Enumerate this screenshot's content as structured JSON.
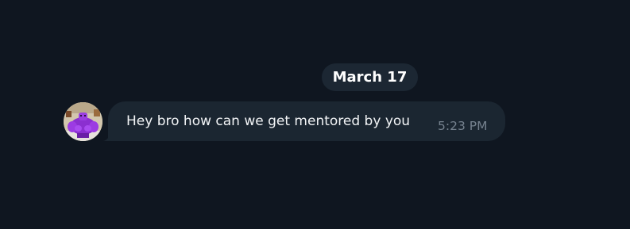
{
  "conversation": {
    "date_separator": "March 17",
    "messages": [
      {
        "text": "Hey bro how can we get mentored by you",
        "time": "5:23 PM",
        "sender_avatar": "purple-muscle-character-avatar"
      }
    ]
  },
  "colors": {
    "background": "#0f1620",
    "bubble": "#1b2631",
    "date_chip": "#1c2733",
    "text": "#f2f4f6",
    "timestamp": "#75818e"
  }
}
